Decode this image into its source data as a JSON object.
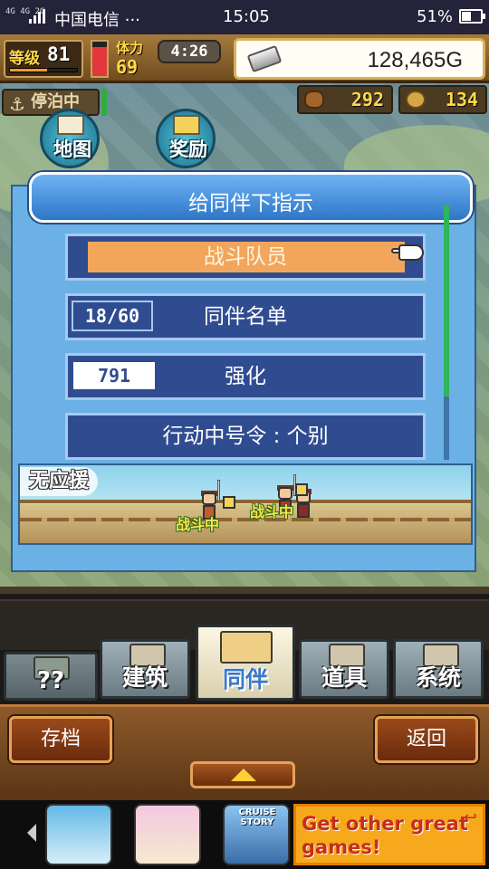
{
  "status_bar": {
    "network": "4G 4G 2G",
    "carrier": "中国电信 ···",
    "time": "15:05",
    "battery": "51%",
    "battery_level": 0.51
  },
  "hud": {
    "level_label": "等级",
    "level": "81",
    "level_progress": 0.55,
    "stamina_label": "体力",
    "stamina": "69",
    "stamina_fill": 0.85,
    "timer": "4:26",
    "gold": "128,465G",
    "docked_label": "停泊中",
    "wood": "292",
    "medals": "134"
  },
  "map_buttons": {
    "map": "地图",
    "reward": "奖励"
  },
  "dialog": {
    "title": "给同伴下指示",
    "items": [
      {
        "label": "战斗队员"
      },
      {
        "label": "同伴名单",
        "tag": "18/60"
      },
      {
        "label": "强化",
        "tag": "791"
      },
      {
        "label": "行动中号令 : 个别"
      }
    ],
    "support_label": "无应援",
    "battle_badges": [
      "战斗中",
      "战斗中"
    ]
  },
  "tabs": [
    {
      "label": "??",
      "icon": "mystery-icon"
    },
    {
      "label": "建筑",
      "icon": "building-icon"
    },
    {
      "label": "同伴",
      "icon": "companion-icon"
    },
    {
      "label": "道具",
      "icon": "items-icon"
    },
    {
      "label": "系统",
      "icon": "system-icon"
    }
  ],
  "bottom_bar": {
    "save": "存档",
    "back": "返回"
  },
  "ad": {
    "tile_3_text": "CRUISE STORY",
    "cta": "Get other great games!"
  },
  "colors": {
    "dialog_bg": "#6bb1e6",
    "menu_item_bg": "#304c91",
    "highlight": "#f2a65b",
    "hud_gold": "#ffd84a"
  }
}
